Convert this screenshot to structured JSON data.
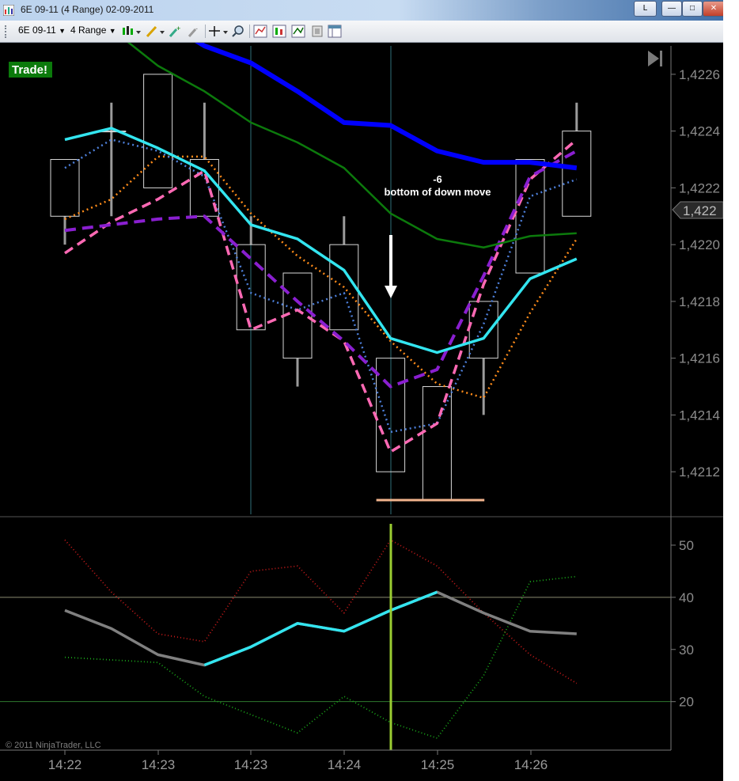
{
  "window": {
    "title": "6E 09-11 (4 Range)  02-09-2011",
    "buttons": {
      "link_label": "L",
      "minimize": "—",
      "maximize": "□",
      "close": "✕"
    }
  },
  "toolbar": {
    "instrument": "6E 09-11",
    "period": "4 Range",
    "icons": [
      "chart-style-icon",
      "drawing-tool-icon",
      "add-marker-icon",
      "remove-marker-icon",
      "crosshair-icon",
      "zoom-icon",
      "indicators-icon",
      "strategies-icon",
      "chart-trader-icon",
      "properties-icon",
      "data-box-icon"
    ]
  },
  "chart": {
    "badge": "Trade!",
    "annotation_value": "-6",
    "annotation_text": "bottom of down move",
    "copyright": "© 2011 NinjaTrader, LLC",
    "current_price_label": "1,422",
    "price_ticks": [
      "1,4226",
      "1,4224",
      "1,4222",
      "1,4220",
      "1,4218",
      "1,4216",
      "1,4214",
      "1,4212"
    ],
    "osc_ticks": [
      "50",
      "40",
      "30",
      "20"
    ],
    "time_ticks": [
      "14:22",
      "14:23",
      "14:23",
      "14:24",
      "14:25",
      "14:26"
    ],
    "colors": {
      "badge_bg": "#0b7a0b",
      "cursor_line": "#9acd32",
      "cyan": "#33e5f0",
      "blue": "#0000ff",
      "green": "#0c7a0c",
      "orange": "#ff8c1a",
      "pink": "#ff69b4",
      "purple": "#8a1fd0",
      "steel": "#4d7fd9"
    }
  },
  "chart_data": {
    "type": "line",
    "price_ylim": [
      1.42105,
      1.4227
    ],
    "osc_ylim": [
      11,
      55
    ],
    "bars": [
      {
        "o": 1.4223,
        "h": 1.4223,
        "l": 1.422,
        "c": 1.4221
      },
      {
        "o": 1.4224,
        "h": 1.4225,
        "l": 1.4221,
        "c": 1.4224
      },
      {
        "o": 1.4226,
        "h": 1.4226,
        "l": 1.4222,
        "c": 1.4222
      },
      {
        "o": 1.4223,
        "h": 1.4225,
        "l": 1.4221,
        "c": 1.4221
      },
      {
        "o": 1.422,
        "h": 1.4221,
        "l": 1.4217,
        "c": 1.4217
      },
      {
        "o": 1.4219,
        "h": 1.4219,
        "l": 1.4215,
        "c": 1.4216
      },
      {
        "o": 1.422,
        "h": 1.4221,
        "l": 1.4217,
        "c": 1.4217
      },
      {
        "o": 1.4216,
        "h": 1.4216,
        "l": 1.4212,
        "c": 1.4212
      },
      {
        "o": 1.4215,
        "h": 1.4215,
        "l": 1.4211,
        "c": 1.4211
      },
      {
        "o": 1.4216,
        "h": 1.4218,
        "l": 1.4214,
        "c": 1.4218
      },
      {
        "o": 1.4219,
        "h": 1.4223,
        "l": 1.4219,
        "c": 1.4223
      },
      {
        "o": 1.4221,
        "h": 1.4225,
        "l": 1.4221,
        "c": 1.4224
      }
    ],
    "price_series": [
      {
        "color": "#ff8c1a",
        "dash": "2 4",
        "width": 2.5,
        "values": [
          1.42209,
          1.42216,
          1.42231,
          1.42231,
          1.42211,
          1.42196,
          1.42185,
          1.42166,
          1.42151,
          1.42146,
          1.42176,
          1.42202
        ]
      },
      {
        "color": "#4d7fd9",
        "dash": "2 4",
        "width": 2.5,
        "values": [
          1.42227,
          1.42237,
          1.42233,
          1.42224,
          1.42183,
          1.42177,
          1.42183,
          1.42134,
          1.42137,
          1.42172,
          1.42217,
          1.42223
        ]
      },
      {
        "color": "#ff69b4",
        "dash": "12 7",
        "width": 3.5,
        "values": [
          1.42197,
          1.42208,
          1.42216,
          1.42226,
          1.4217,
          1.42177,
          1.42166,
          1.42127,
          1.42137,
          1.42186,
          1.42223,
          1.42237
        ]
      },
      {
        "color": "#8a1fd0",
        "dash": "14 8",
        "width": 4,
        "values": [
          1.42205,
          1.42207,
          1.42209,
          1.4221,
          1.42195,
          1.4218,
          1.42166,
          1.4215,
          1.42156,
          1.42189,
          1.42224,
          1.42233
        ]
      },
      {
        "color": "#0c7a0c",
        "dash": "",
        "width": 2.5,
        "values": [
          1.4229,
          1.42276,
          1.42263,
          1.42254,
          1.42243,
          1.42236,
          1.42227,
          1.42211,
          1.42202,
          1.42199,
          1.42203,
          1.42204
        ]
      },
      {
        "color": "#0000ff",
        "dash": "",
        "width": 6,
        "values": [
          1.423,
          1.4229,
          1.4228,
          1.4227,
          1.42264,
          1.42254,
          1.42243,
          1.42242,
          1.42233,
          1.42229,
          1.42229,
          1.42227
        ]
      },
      {
        "color": "#33e5f0",
        "dash": "",
        "width": 3.5,
        "values": [
          1.42237,
          1.42241,
          1.42234,
          1.42226,
          1.42207,
          1.42202,
          1.42191,
          1.42167,
          1.42162,
          1.42167,
          1.42188,
          1.42195
        ]
      }
    ],
    "price_extra": {
      "line_color": "#0c7a0c"
    },
    "osc_series": [
      {
        "name": "",
        "color": "#c81a1a",
        "dash": "1 3",
        "width": 1.8,
        "values": [
          51,
          41,
          33,
          31.5,
          45,
          46,
          37,
          51,
          46,
          37,
          29,
          23.5
        ]
      },
      {
        "name": "",
        "color": "#1aa81a",
        "dash": "1 3",
        "width": 1.8,
        "values": [
          28.5,
          28,
          27.5,
          21,
          17.5,
          14,
          21,
          16,
          13,
          25,
          43,
          44
        ]
      },
      {
        "name": "",
        "color": "#808080",
        "dash": "",
        "width": 3.5,
        "values": [
          37.5,
          34,
          29,
          27,
          30.5,
          35,
          33.5,
          37.5,
          41,
          37,
          33.5,
          33
        ]
      }
    ],
    "osc_cyan_from": 3,
    "osc_cyan_to": 8,
    "osc_hlines": [
      40,
      20
    ]
  }
}
